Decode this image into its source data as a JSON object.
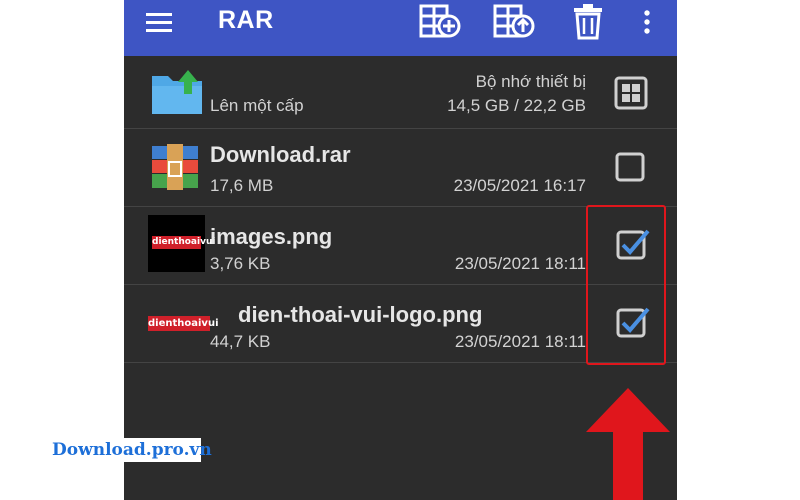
{
  "appbar": {
    "title": "RAR",
    "tools": [
      "archive-add-icon",
      "extract-icon",
      "delete-icon",
      "more-vert-icon"
    ]
  },
  "storage": {
    "up_label": "Lên một cấp",
    "device_label": "Bộ nhớ thiết bị",
    "usage": "14,5 GB / 22,2 GB"
  },
  "files": [
    {
      "name": "Download.rar",
      "size": "17,6 MB",
      "date": "23/05/2021 16:17",
      "checked": false,
      "icon": "winrar-archive-icon"
    },
    {
      "name": "images.png",
      "size": "3,76 KB",
      "date": "23/05/2021 18:11",
      "checked": true,
      "icon": "image-thumbnail",
      "badge": "dienthoaivui"
    },
    {
      "name": "dien-thoai-vui-logo.png",
      "size": "44,7 KB",
      "date": "23/05/2021 18:11",
      "checked": true,
      "icon": "image-thumbnail",
      "badge": "dienthoaivui"
    }
  ],
  "colors": {
    "appbar": "#3e55c4",
    "background": "#2c2c2c",
    "check_accent": "#4a90e2",
    "annotation_red": "#e0161c"
  },
  "watermark": "Download.pro.vn"
}
